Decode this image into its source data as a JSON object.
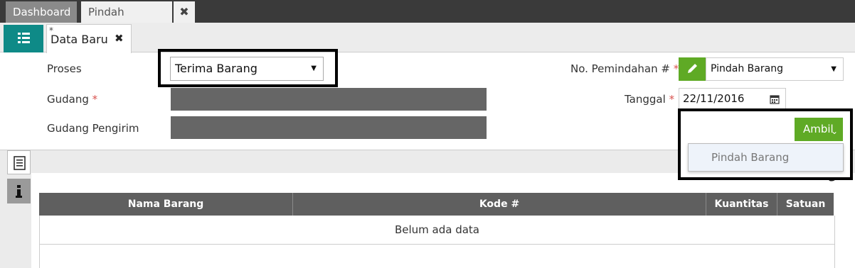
{
  "top_tabs": {
    "dashboard": "Dashboard",
    "pindah_barang": "Pindah Barang",
    "close": "✖"
  },
  "sub_tab": {
    "label": "Data Baru",
    "dirty_mark": "*",
    "close": "✖"
  },
  "form": {
    "proses_label": "Proses",
    "proses_value": "Terima Barang",
    "gudang_label": "Gudang",
    "gudang_pengirim_label": "Gudang Pengirim",
    "required_mark": "*",
    "no_pemindahan_label": "No. Pemindahan #",
    "no_pemindahan_value": "Pindah Barang",
    "tanggal_label": "Tanggal",
    "tanggal_value": "22/11/2016"
  },
  "ambil": {
    "button_label": "Ambil",
    "menu_items": [
      "Pindah Barang"
    ]
  },
  "detail": {
    "title": "Detail Barang",
    "columns": [
      "Nama Barang",
      "Kode #",
      "Kuantitas",
      "Satuan"
    ],
    "empty_text": "Belum ada data"
  },
  "icons": {
    "list": "list-icon",
    "pencil": "pencil-icon",
    "calendar": "calendar-icon",
    "document": "document-icon",
    "info": "info-icon",
    "caret": "caret-down-icon",
    "chevron": "chevron-down-icon"
  },
  "colors": {
    "teal": "#0e8a87",
    "green": "#5faa25",
    "gray_field": "#666666",
    "header": "#5f5f5f"
  }
}
